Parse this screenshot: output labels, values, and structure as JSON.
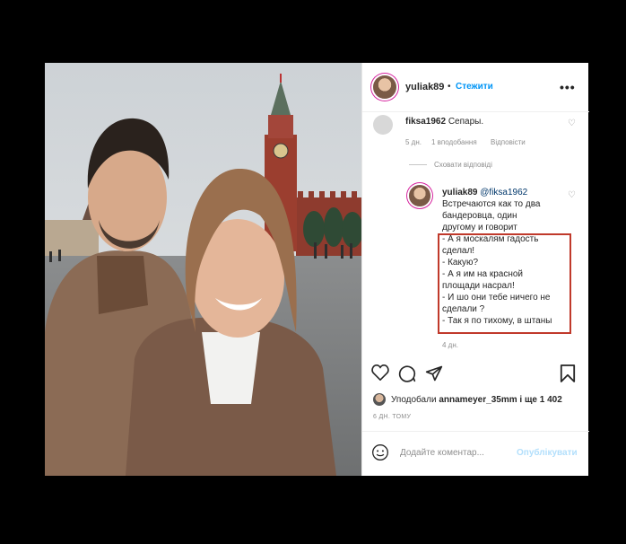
{
  "post": {
    "username": "yuliak89",
    "separator": "•",
    "follow_label": "Стежити",
    "more_label": "•••"
  },
  "comments": [
    {
      "user": "fiksa1962",
      "text": "Сепары.",
      "time": "5 дн.",
      "likes": "1 вподобання",
      "reply": "Відповісти"
    }
  ],
  "hide_replies": "Сховати відповіді",
  "reply": {
    "user": "yuliak89",
    "mention": "@fiksa1962",
    "lines": [
      "Встречаются как то два",
      "бандеровца, один",
      "другому и говорит",
      "- А я москалям гадость",
      "сделал!",
      "- Какую?",
      "- А я им на красной",
      "площади насрал!",
      "- И шо они тебе ничего не",
      "сделали ?",
      "- Так я по тихому, в штаны"
    ],
    "time": "4 дн."
  },
  "likes": {
    "prefix": "Уподобали",
    "user": "annameyer_35mm",
    "suffix": "і ще 1 402"
  },
  "posted_ago": "6 ДН. ТОМУ",
  "add_comment": {
    "placeholder": "Додайте коментар...",
    "publish_label": "Опублікувати"
  },
  "icons": {
    "avatar": "avatar-icon",
    "heart": "heart-icon",
    "comment": "comment-icon",
    "share": "send-icon",
    "save": "bookmark-icon",
    "emoji": "emoji-icon"
  },
  "colors": {
    "follow": "#0095f6",
    "highlight_box": "#c0392b",
    "mention": "#00376b"
  }
}
